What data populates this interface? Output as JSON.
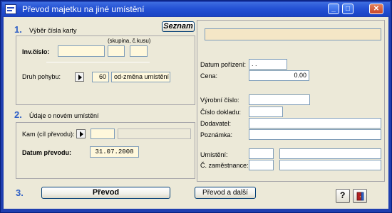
{
  "window": {
    "title": "Převod majetku na jiné umístění",
    "minimize": "_",
    "maximize": "□",
    "close": "✕"
  },
  "section1": {
    "number": "1.",
    "label": "Výběr čísla karty",
    "seznam_button": "Seznam",
    "group_hint": "(skupina, č.kusu)",
    "inv_label": "Inv.číslo:",
    "inv_value": "",
    "skupina_value": "",
    "kus_value": "",
    "druh_label": "Druh pohybu:",
    "druh_code": "60",
    "druh_text": "od-změna umístění"
  },
  "section2": {
    "number": "2.",
    "label": "Údaje o novém umístění",
    "kam_label": "Kam (cíl převodu):",
    "kam_code": "",
    "kam_name": "",
    "datum_label": "Datum převodu:",
    "datum_value": "31.07.2008"
  },
  "section3": {
    "number": "3.",
    "prevod_button": "Převod",
    "prevod_dalsi_button": "Převod a další"
  },
  "details": {
    "name_value": "",
    "datum_porizeni_label": "Datum pořízení:",
    "datum_porizeni_value": ". .",
    "cena_label": "Cena:",
    "cena_value": "0.00",
    "vyrobni_cislo_label": "Výrobní číslo:",
    "vyrobni_cislo_value": "",
    "cislo_dokladu_label": "Číslo dokladu:",
    "cislo_dokladu_value": "",
    "dodavatel_label": "Dodavatel:",
    "dodavatel_value": "",
    "poznamka_label": "Poznámka:",
    "poznamka_value": "",
    "umisteni_label": "Umístění:",
    "umisteni_code": "",
    "umisteni_name": "",
    "zamestnance_label": "Č. zaměstnance:",
    "zamestnance_code": "",
    "zamestnance_name": ""
  },
  "footer": {
    "help_icon": "question-mark-icon",
    "exit_icon": "exit-door-icon",
    "help_glyph": "?"
  }
}
